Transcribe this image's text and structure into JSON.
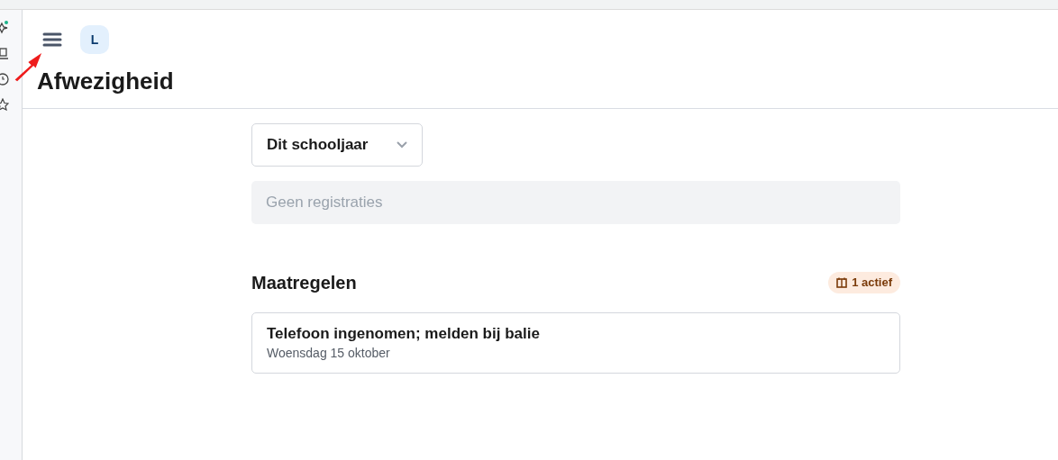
{
  "header": {
    "avatar": "L",
    "title": "Afwezigheid"
  },
  "period_select": {
    "value": "Dit schooljaar"
  },
  "registrations": {
    "empty_text": "Geen registraties"
  },
  "measures": {
    "title": "Maatregelen",
    "badge": "1 actief",
    "items": [
      {
        "title": "Telefoon ingenomen; melden bij balie",
        "date": "Woensdag 15 oktober"
      }
    ]
  }
}
